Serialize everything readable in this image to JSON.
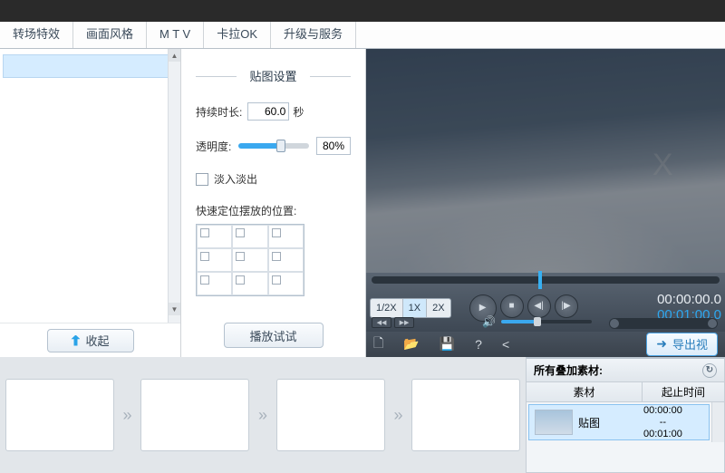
{
  "tabs": [
    "转场特效",
    "画面风格",
    "M T V",
    "卡拉OK",
    "升级与服务"
  ],
  "panel": {
    "title": "贴图设置",
    "duration_label": "持续时长:",
    "duration_value": "60.0",
    "duration_unit": "秒",
    "opacity_label": "透明度:",
    "opacity_value": "80%",
    "fade_label": "淡入淡出",
    "position_label": "快速定位摆放的位置:",
    "play_btn": "播放试试"
  },
  "collapse_btn": "收起",
  "speed": {
    "half": "1/2X",
    "one": "1X",
    "two": "2X"
  },
  "timecode": {
    "current": "00:00:00.0",
    "total": "00:01:00.0"
  },
  "watermark": {
    "big": "X",
    "small": ""
  },
  "toolbar_icons": {
    "new": "🗋",
    "open": "📂",
    "save": "💾",
    "help": "?",
    "share": "<"
  },
  "export_btn": "导出视",
  "overlay": {
    "header": "所有叠加素材:",
    "col_material": "素材",
    "col_time": "起止时间",
    "row": {
      "name": "贴图",
      "t1": "00:00:00",
      "sep": "--",
      "t2": "00:01:00"
    }
  }
}
